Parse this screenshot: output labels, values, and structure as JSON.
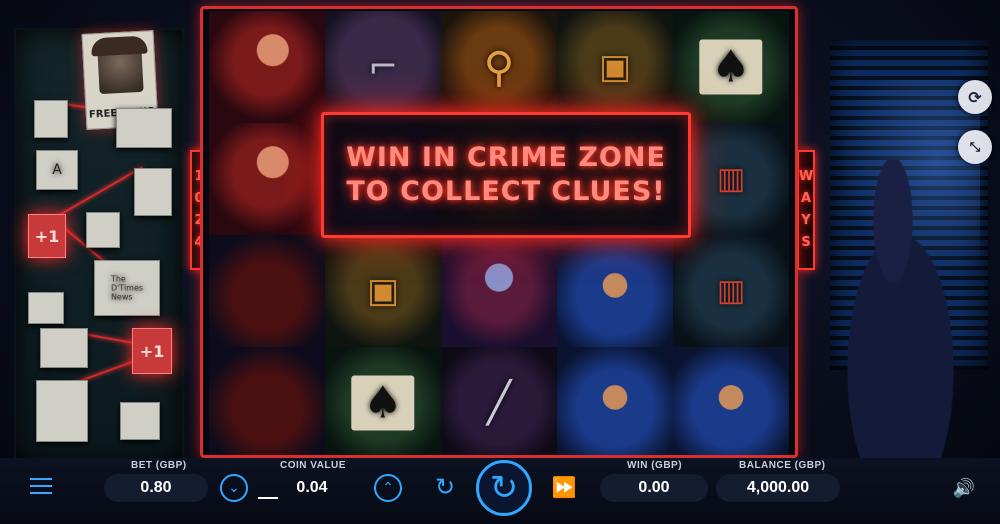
{
  "game": {
    "banner": "WIN IN CRIME ZONE TO COLLECT CLUES!",
    "ways_left": [
      "1",
      "0",
      "2",
      "4"
    ],
    "ways_right": [
      "W",
      "A",
      "Y",
      "S"
    ],
    "free_spins_label": "FREE SPINS",
    "clue_plus": "+1",
    "news_label": "The D'Times News"
  },
  "reels": [
    [
      "woman",
      "gun",
      "magnifier",
      "whiskey",
      "card"
    ],
    [
      "woman",
      "knife",
      "",
      "",
      "matches"
    ],
    [
      "hatman",
      "whiskey",
      "woman-blue",
      "detective",
      "matches"
    ],
    [
      "hatman",
      "card",
      "knife",
      "detective",
      "detective"
    ]
  ],
  "controls": {
    "bet_caption": "BET (GBP)",
    "bet_value": "0.80",
    "coin_caption": "COIN VALUE",
    "coin_value": "0.04",
    "win_caption": "WIN (GBP)",
    "win_value": "0.00",
    "balance_caption": "BALANCE (GBP)",
    "balance_value": "4,000.00"
  },
  "icons": {
    "menu": "menu-icon",
    "decrease": "chevron-down-icon",
    "increase": "chevron-up-icon",
    "autoplay": "autoplay-icon",
    "spin": "spin-icon",
    "turbo": "fast-forward-icon",
    "sound": "speaker-icon",
    "reload": "reload-icon",
    "fullscreen": "exit-fullscreen-icon"
  },
  "colors": {
    "neon_red": "#ff3a30",
    "accent_blue": "#2ea8ff"
  }
}
